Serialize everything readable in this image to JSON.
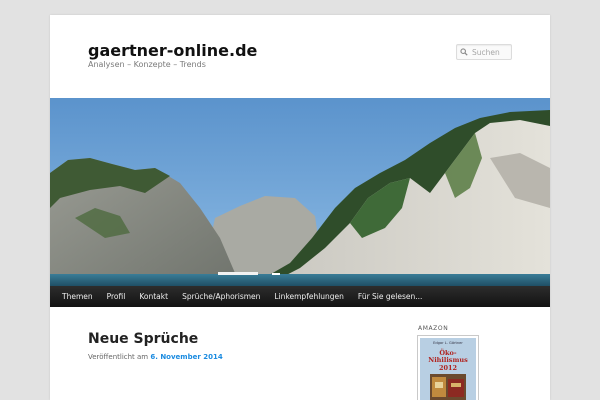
{
  "site": {
    "title": "gaertner-online.de",
    "description": "Analysen – Konzepte – Trends"
  },
  "search": {
    "placeholder": "Suchen",
    "icon": "search-icon"
  },
  "nav": {
    "items": [
      {
        "label": "Themen"
      },
      {
        "label": "Profil"
      },
      {
        "label": "Kontakt"
      },
      {
        "label": "Sprüche/Aphorismen"
      },
      {
        "label": "Linkempfehlungen"
      },
      {
        "label": "Für Sie gelesen..."
      }
    ]
  },
  "post": {
    "title": "Neue Sprüche",
    "meta_prefix": "Veröffentlicht am",
    "date": "6. November 2014"
  },
  "sidebar": {
    "widget_title": "AMAZON",
    "book": {
      "author": "Edgar L. Gärtner",
      "title_line1": "Öko-",
      "title_line2": "Nihilismus",
      "year": "2012"
    }
  },
  "colors": {
    "page_bg": "#e2e2e2",
    "nav_bg": "#1f1f1f",
    "link": "#1b8be0",
    "sky": "#6ea2d4",
    "sea": "#2d6b86"
  }
}
